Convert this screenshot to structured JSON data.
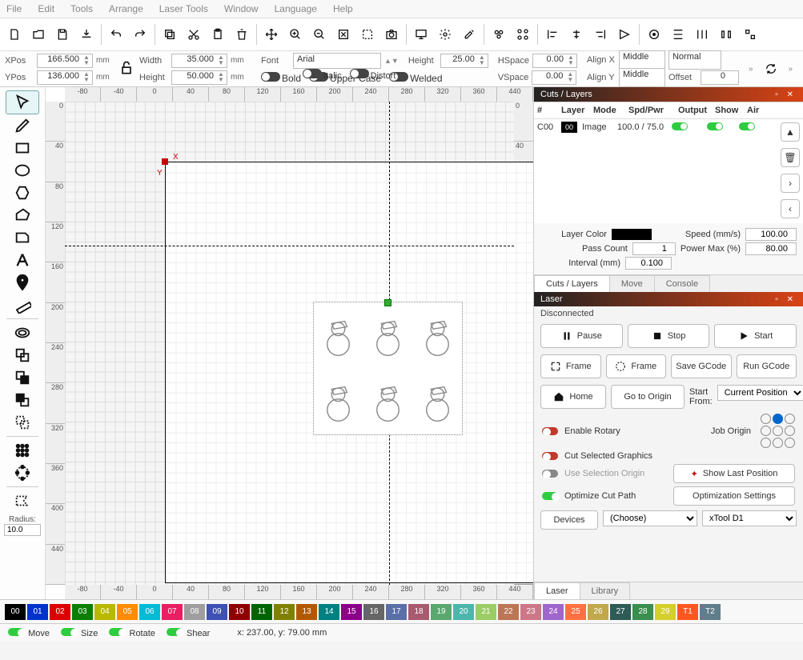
{
  "menu": {
    "items": [
      "File",
      "Edit",
      "Tools",
      "Arrange",
      "Laser Tools",
      "Window",
      "Language",
      "Help"
    ]
  },
  "prop": {
    "xpos_label": "XPos",
    "xpos": "166.500",
    "ypos_label": "YPos",
    "ypos": "136.000",
    "unit": "mm",
    "width_label": "Width",
    "width": "35.000",
    "height_label": "Height",
    "height": "50.000",
    "font_label": "Font",
    "font_name": "Arial",
    "font_height_label": "Height",
    "font_height": "25.00",
    "bold": "Bold",
    "uc": "Upper Case",
    "welded": "Welded",
    "italic": "Italic",
    "distort": "Distort",
    "hspace_label": "HSpace",
    "hspace": "0.00",
    "vspace_label": "VSpace",
    "vspace": "0.00",
    "alignx": "Align X",
    "aligny": "Align Y",
    "alignx_val": "Middle",
    "aligny_val": "Middle",
    "normal": "Normal",
    "offset_label": "Offset",
    "offset": "0"
  },
  "radius": {
    "label": "Radius:",
    "value": "10.0"
  },
  "ruler": [
    "-80",
    "-40",
    "0",
    "40",
    "80",
    "120",
    "160",
    "200",
    "240",
    "280",
    "320",
    "360",
    "440"
  ],
  "ruler_v": [
    "0",
    "40",
    "80",
    "120",
    "160",
    "200",
    "240",
    "280",
    "320",
    "360",
    "400",
    "440"
  ],
  "cuts": {
    "title": "Cuts / Layers",
    "cols": {
      "n": "#",
      "layer": "Layer",
      "mode": "Mode",
      "spd": "Spd/Pwr",
      "out": "Output",
      "show": "Show",
      "air": "Air"
    },
    "row": {
      "id": "C00",
      "swatch": "00",
      "mode": "Image",
      "spd": "100.0 / 75.0"
    },
    "props": {
      "layer_color": "Layer Color",
      "speed": "Speed (mm/s)",
      "speed_v": "100.00",
      "pass": "Pass Count",
      "pass_v": "1",
      "pmax": "Power Max (%)",
      "pmax_v": "80.00",
      "interval": "Interval (mm)",
      "interval_v": "0.100"
    }
  },
  "tabs_mid": [
    "Cuts / Layers",
    "Move",
    "Console"
  ],
  "laser": {
    "title": "Laser",
    "status": "Disconnected",
    "pause": "Pause",
    "stop": "Stop",
    "start": "Start",
    "frame1": "Frame",
    "frame2": "Frame",
    "save": "Save GCode",
    "run": "Run GCode",
    "home": "Home",
    "goto": "Go to Origin",
    "startfrom": "Start From:",
    "startfrom_v": "Current Position",
    "enable_rotary": "Enable Rotary",
    "job_origin": "Job Origin",
    "cut_sel": "Cut Selected Graphics",
    "use_sel": "Use Selection Origin",
    "opt_path": "Optimize Cut Path",
    "show_last": "Show Last Position",
    "opt_set": "Optimization Settings",
    "devices": "Devices",
    "choose": "(Choose)",
    "xtool": "xTool D1"
  },
  "tabs_bot": [
    "Laser",
    "Library"
  ],
  "palette": [
    {
      "t": "00",
      "c": "#000"
    },
    {
      "t": "01",
      "c": "#0033cc"
    },
    {
      "t": "02",
      "c": "#d00"
    },
    {
      "t": "03",
      "c": "#0a7e07"
    },
    {
      "t": "04",
      "c": "#b8b800"
    },
    {
      "t": "05",
      "c": "#ff8c00"
    },
    {
      "t": "06",
      "c": "#00bcd4"
    },
    {
      "t": "07",
      "c": "#e91e63"
    },
    {
      "t": "08",
      "c": "#9e9e9e"
    },
    {
      "t": "09",
      "c": "#3f51b5"
    },
    {
      "t": "10",
      "c": "#8d0000"
    },
    {
      "t": "11",
      "c": "#006400"
    },
    {
      "t": "12",
      "c": "#808000"
    },
    {
      "t": "13",
      "c": "#b25900"
    },
    {
      "t": "14",
      "c": "#008080"
    },
    {
      "t": "15",
      "c": "#8b008b"
    },
    {
      "t": "16",
      "c": "#666"
    },
    {
      "t": "17",
      "c": "#5a6fa8"
    },
    {
      "t": "18",
      "c": "#a85a6f"
    },
    {
      "t": "19",
      "c": "#5aa86f"
    },
    {
      "t": "20",
      "c": "#4db6ac"
    },
    {
      "t": "21",
      "c": "#9ccc65"
    },
    {
      "t": "22",
      "c": "#bb7755"
    },
    {
      "t": "23",
      "c": "#cc7788"
    },
    {
      "t": "24",
      "c": "#a066cc"
    },
    {
      "t": "25",
      "c": "#ff7043"
    },
    {
      "t": "26",
      "c": "#c2a84d"
    },
    {
      "t": "27",
      "c": "#2e5b56"
    },
    {
      "t": "28",
      "c": "#3a8f4f"
    },
    {
      "t": "29",
      "c": "#d4cf2a"
    },
    {
      "t": "T1",
      "c": "#ff5722"
    },
    {
      "t": "T2",
      "c": "#607d8b"
    }
  ],
  "status": {
    "move": "Move",
    "size": "Size",
    "rotate": "Rotate",
    "shear": "Shear",
    "coords": "x: 237.00, y: 79.00 mm"
  }
}
